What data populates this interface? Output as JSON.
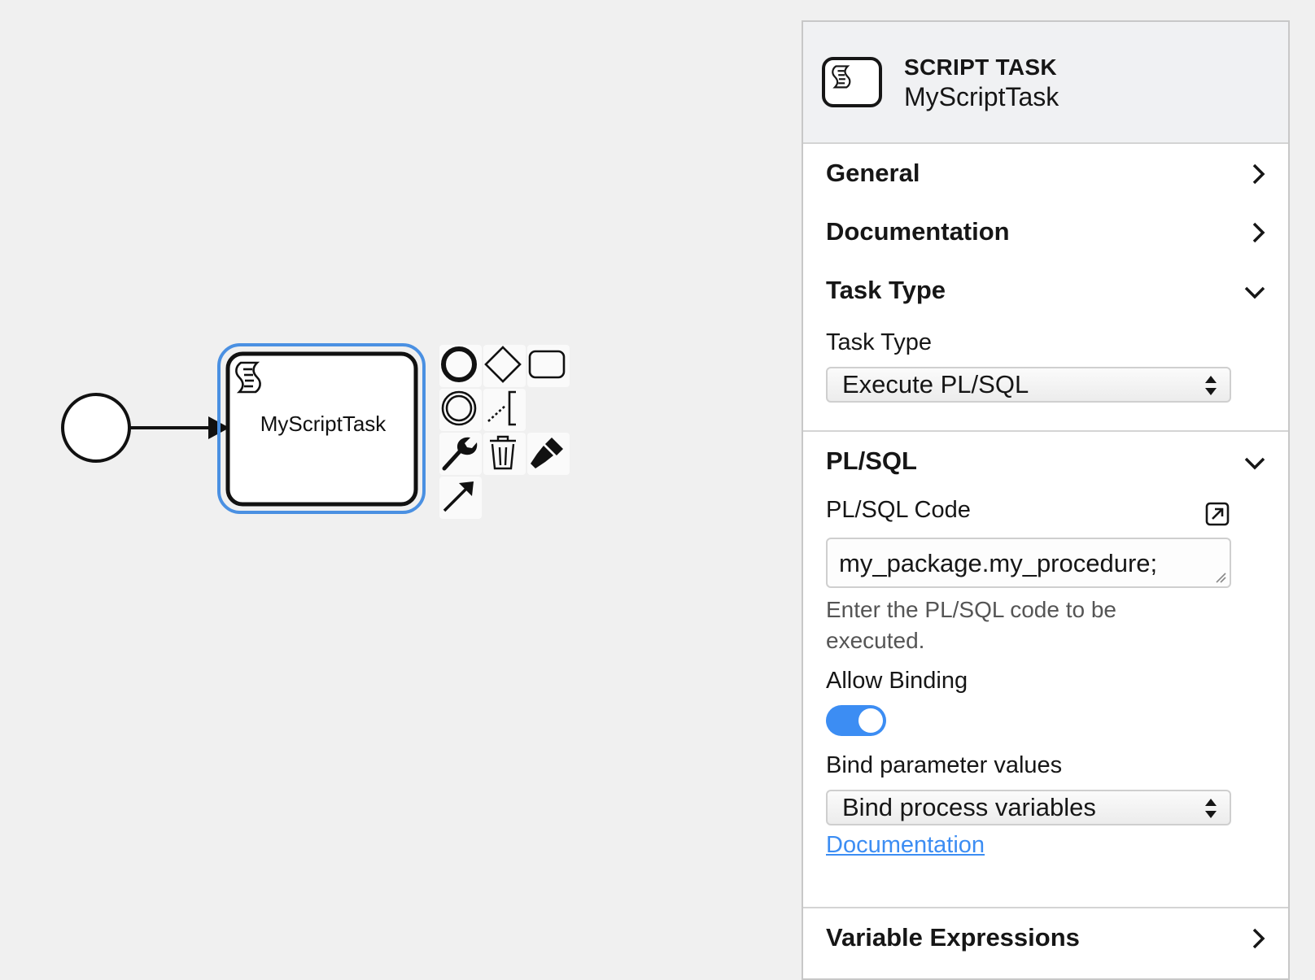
{
  "canvas": {
    "task_label": "MyScriptTask",
    "selection_color": "#4a90e2",
    "context_pad": [
      {
        "name": "append-end-event-icon"
      },
      {
        "name": "append-gateway-icon"
      },
      {
        "name": "append-task-icon"
      },
      {
        "name": "append-intermediate-event-icon"
      },
      {
        "name": "text-annotation-icon"
      },
      {
        "name": "wrench-icon"
      },
      {
        "name": "trash-icon"
      },
      {
        "name": "paintbrush-icon"
      },
      {
        "name": "connect-arrow-icon"
      }
    ]
  },
  "panel": {
    "header": {
      "type": "SCRIPT TASK",
      "name": "MyScriptTask",
      "icon": "script-task-icon"
    },
    "groups": {
      "general": "General",
      "documentation": "Documentation",
      "task_type": "Task Type",
      "plsql": "PL/SQL",
      "variable_expressions": "Variable Expressions"
    },
    "task_type": {
      "label": "Task Type",
      "value": "Execute PL/SQL"
    },
    "plsql": {
      "code_label": "PL/SQL Code",
      "code_value": "my_package.my_procedure;",
      "hint": "Enter the PL/SQL code to be executed.",
      "allow_binding_label": "Allow Binding",
      "allow_binding_on": true,
      "bind_label": "Bind parameter values",
      "bind_value": "Bind process variables",
      "doc_link": "Documentation"
    },
    "accent_color": "#3c8df3"
  }
}
